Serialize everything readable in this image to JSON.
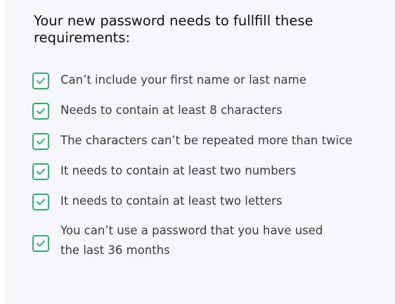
{
  "title": "Your new password needs to fullfill these requirements:",
  "accent_color": "#2fb36c",
  "requirements": [
    {
      "text": "Can’t include your first name or last name",
      "checked": true
    },
    {
      "text": "Needs to contain at least 8 characters",
      "checked": true
    },
    {
      "text": "The characters can’t be repeated more than twice",
      "checked": true
    },
    {
      "text": "It needs to contain at least two numbers",
      "checked": true
    },
    {
      "text": "It needs to contain at least two letters",
      "checked": true
    },
    {
      "text_line1": "You can’t use a password that you have used",
      "text_line2": "the last 36 months",
      "checked": true
    }
  ],
  "icons": {
    "checkbox": "check-icon"
  }
}
